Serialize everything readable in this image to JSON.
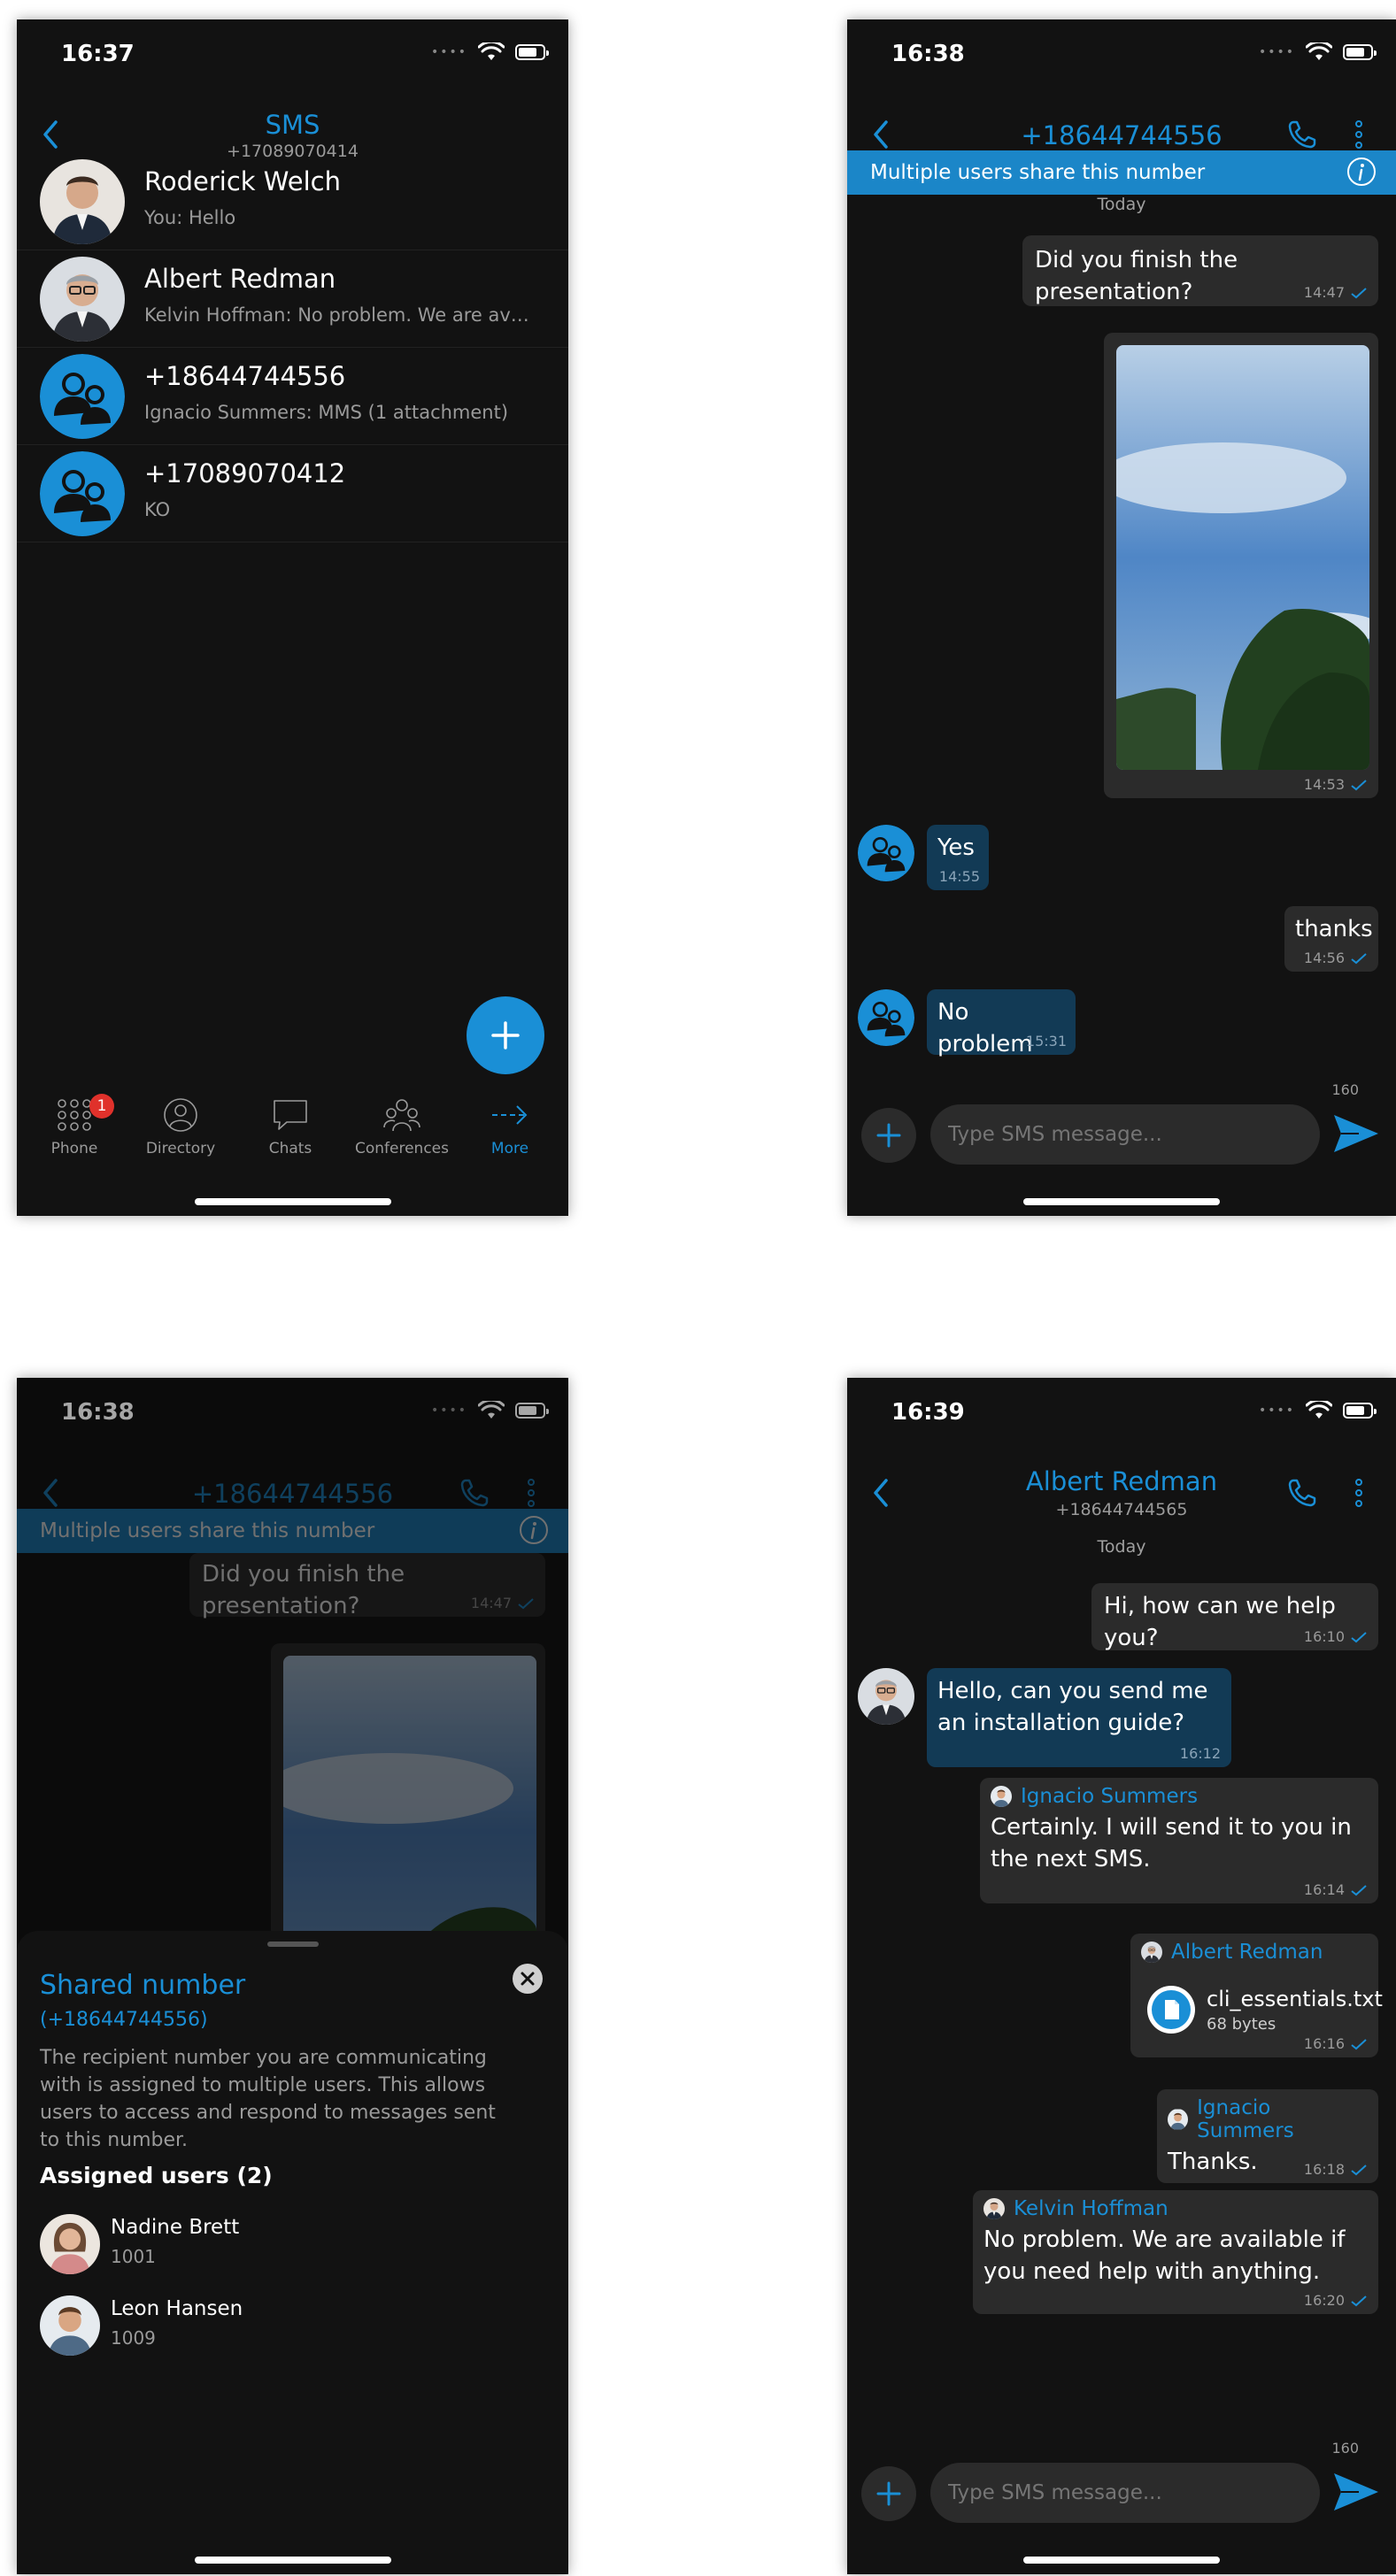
{
  "status_times": [
    "16:37",
    "16:38",
    "16:38",
    "16:39"
  ],
  "sms_list": {
    "title": "SMS",
    "subtitle": "+17089070414",
    "conversations": [
      {
        "name": "Roderick Welch",
        "preview": "You: Hello"
      },
      {
        "name": "Albert Redman",
        "preview": "Kelvin Hoffman: No problem. We are ava..."
      },
      {
        "name": "+18644744556",
        "preview": "Ignacio Summers: MMS (1 attachment)"
      },
      {
        "name": "+17089070412",
        "preview": "KO"
      }
    ],
    "tabs": [
      {
        "label": "Phone",
        "badge": "1"
      },
      {
        "label": "Directory"
      },
      {
        "label": "Chats"
      },
      {
        "label": "Conferences"
      },
      {
        "label": "More"
      }
    ]
  },
  "shared_chat": {
    "title": "+18644744556",
    "banner": "Multiple users share this number",
    "day_label": "Today",
    "messages": [
      {
        "dir": "out",
        "text": "Did you finish the presentation?",
        "time": "14:47"
      },
      {
        "dir": "out",
        "kind": "image",
        "time": "14:53"
      },
      {
        "dir": "in",
        "text": "Yes",
        "time": "14:55"
      },
      {
        "dir": "out",
        "text": "thanks",
        "time": "14:56"
      },
      {
        "dir": "in",
        "text": "No problem",
        "time": "15:31"
      }
    ],
    "composer": {
      "placeholder": "Type SMS message...",
      "counter": "160"
    }
  },
  "shared_sheet": {
    "title": "Shared number",
    "number": "(+18644744556)",
    "description": "The recipient number you are communicating with is assigned to multiple users. This allows users to access and respond to messages sent to this number.",
    "assigned_heading": "Assigned users (2)",
    "users": [
      {
        "name": "Nadine Brett",
        "ext": "1001"
      },
      {
        "name": "Leon Hansen",
        "ext": "1009"
      }
    ]
  },
  "albert_chat": {
    "title": "Albert Redman",
    "subtitle": "+18644744565",
    "day_label": "Today",
    "messages": [
      {
        "dir": "out",
        "text": "Hi, how can we help you?",
        "time": "16:10"
      },
      {
        "dir": "in",
        "text": "Hello, can you send me an installation guide?",
        "time": "16:12"
      },
      {
        "dir": "out",
        "sender": "Ignacio Summers",
        "text": "Certainly. I will send it to you in the next SMS.",
        "time": "16:14"
      },
      {
        "dir": "out",
        "sender": "Albert Redman",
        "file_name": "cli_essentials.txt",
        "file_size": "68 bytes",
        "time": "16:16"
      },
      {
        "dir": "out",
        "sender": "Ignacio Summers",
        "text": "Thanks.",
        "time": "16:18"
      },
      {
        "dir": "out",
        "sender": "Kelvin Hoffman",
        "text": "No problem. We are available if you need help with anything.",
        "time": "16:20"
      }
    ],
    "composer": {
      "placeholder": "Type SMS message...",
      "counter": "160"
    }
  },
  "colors": {
    "accent": "#1a8fd6",
    "background": "#121212",
    "bubble_out": "#2b2b2b",
    "bubble_in": "#123a55",
    "badge": "#e0312b"
  }
}
